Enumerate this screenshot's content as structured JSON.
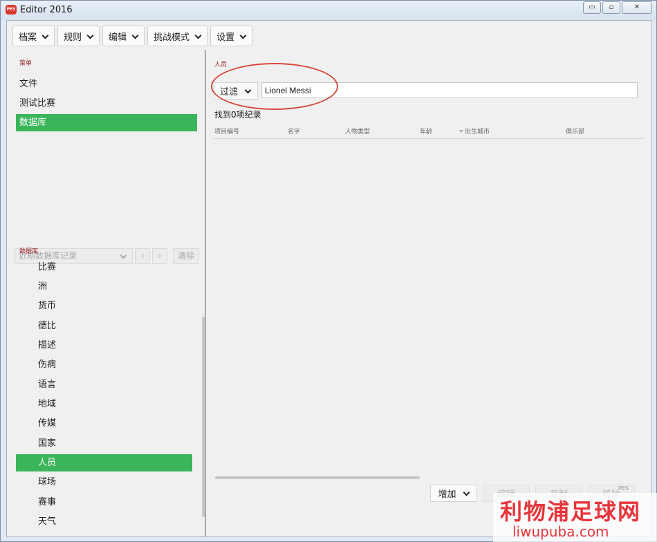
{
  "window": {
    "title": "Editor 2016",
    "app_icon_text": "PES",
    "controls": {
      "minimize": "▭",
      "maximize": "▫",
      "close": "✕"
    }
  },
  "toolbar": {
    "items": [
      {
        "label": "档案"
      },
      {
        "label": "规则"
      },
      {
        "label": "编辑"
      },
      {
        "label": "挑战模式"
      },
      {
        "label": "设置"
      }
    ]
  },
  "left": {
    "menu_header": "菜单",
    "menu_items": [
      {
        "label": "文件",
        "active": false
      },
      {
        "label": "测试比赛",
        "active": false
      },
      {
        "label": "数据库",
        "active": true
      }
    ],
    "recent_placeholder": "近期数据库记录",
    "clear_label": "清除",
    "db_header": "数据库",
    "db_items": [
      {
        "label": "比赛",
        "active": false
      },
      {
        "label": "洲",
        "active": false
      },
      {
        "label": "货币",
        "active": false
      },
      {
        "label": "德比",
        "active": false
      },
      {
        "label": "描述",
        "active": false
      },
      {
        "label": "伤病",
        "active": false
      },
      {
        "label": "语言",
        "active": false
      },
      {
        "label": "地域",
        "active": false
      },
      {
        "label": "传媒",
        "active": false
      },
      {
        "label": "国家",
        "active": false
      },
      {
        "label": "人员",
        "active": true
      },
      {
        "label": "球场",
        "active": false
      },
      {
        "label": "赛事",
        "active": false
      },
      {
        "label": "天气",
        "active": false
      }
    ]
  },
  "right": {
    "section_title": "人员",
    "filter_label": "过滤",
    "search_value": "Lionel Messi",
    "results_count": "找到0项纪录",
    "columns": [
      "项目编号",
      "名字",
      "人物类型",
      "年龄",
      "出生城市",
      "俱乐部"
    ],
    "actions": [
      {
        "label": "增加",
        "dropdown": true,
        "disabled": false
      },
      {
        "label": "编辑",
        "disabled": true
      },
      {
        "label": "复制",
        "disabled": true
      },
      {
        "label": "移除",
        "disabled": true
      }
    ]
  },
  "watermark": {
    "cn": "利物浦足球网",
    "en": "liwupuba.com",
    "badge": "PES"
  },
  "colors": {
    "accent_green": "#3ab55a",
    "section_red": "#9a2424",
    "highlight_red": "#d7493d"
  }
}
